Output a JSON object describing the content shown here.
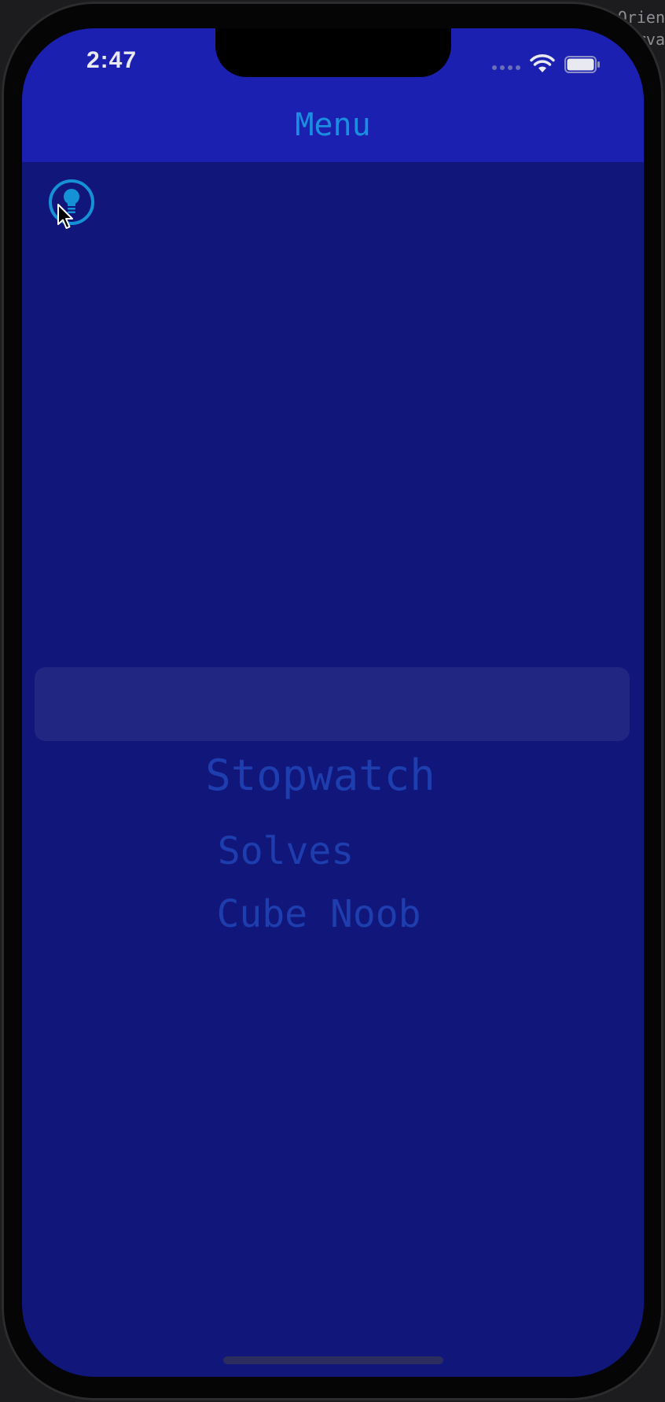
{
  "background_window": {
    "text_lines": [
      "Orien",
      "rva"
    ]
  },
  "status_bar": {
    "time": "2:47",
    "icons": [
      "cellular-icon",
      "wifi-icon",
      "battery-icon"
    ]
  },
  "nav": {
    "title": "Menu"
  },
  "hint_button": {
    "icon": "lightbulb-icon"
  },
  "picker": {
    "items": [
      "Stopwatch",
      "Solves",
      "Cube Noob"
    ]
  },
  "colors": {
    "nav_bar": "#1b20b0",
    "screen_background": "#11167a",
    "nav_title": "#1a8ee0",
    "picker_text": "#1e3dae",
    "hint_accent": "#1591d6"
  }
}
